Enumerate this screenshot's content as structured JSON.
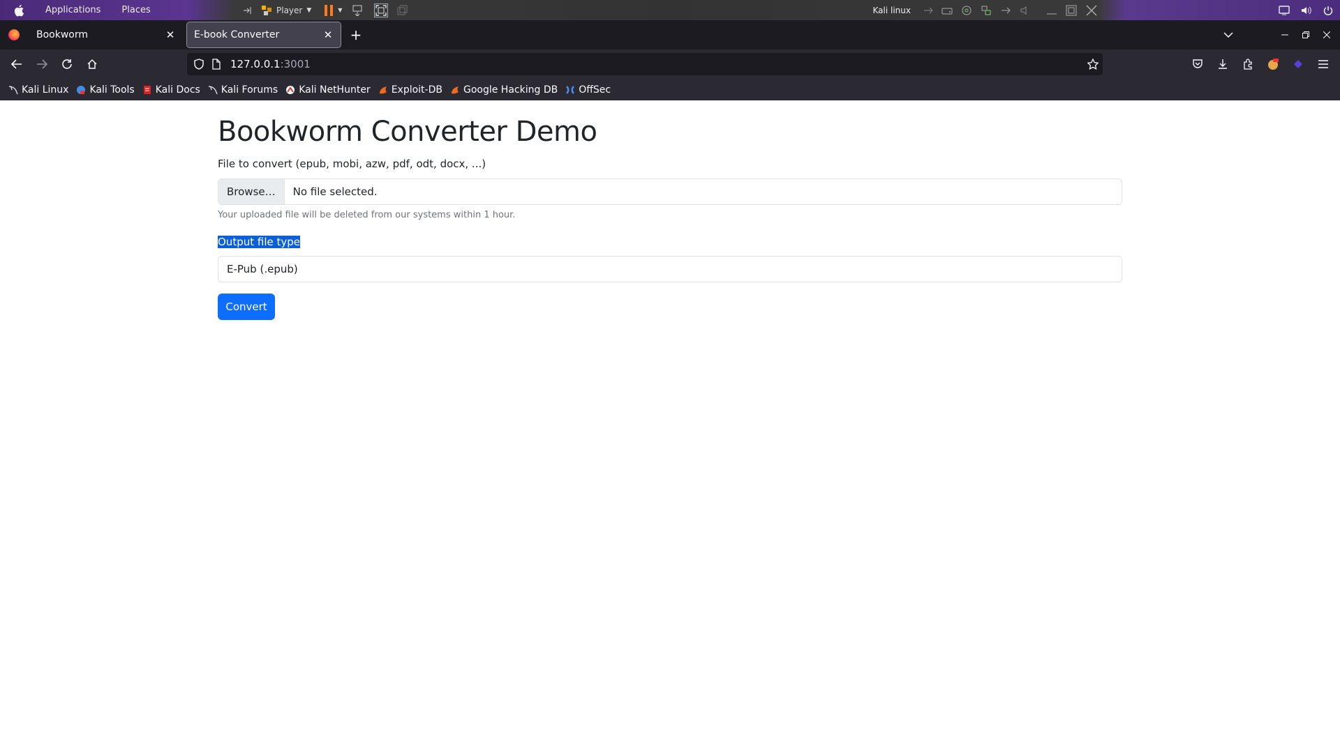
{
  "os_panel": {
    "menus": [
      "Applications",
      "Places"
    ],
    "vm_player_label": "Player",
    "vm_name": "Kali linux"
  },
  "browser": {
    "tabs": [
      {
        "label": "Bookworm",
        "active": false
      },
      {
        "label": "E-book Converter",
        "active": true
      }
    ],
    "url": {
      "host": "127.0.0.1",
      "port": ":3001"
    },
    "bookmarks": [
      {
        "label": "Kali Linux",
        "icon": "kali-dragon-icon"
      },
      {
        "label": "Kali Tools",
        "icon": "kali-tools-icon"
      },
      {
        "label": "Kali Docs",
        "icon": "kali-docs-icon"
      },
      {
        "label": "Kali Forums",
        "icon": "kali-dragon-icon"
      },
      {
        "label": "Kali NetHunter",
        "icon": "nethunter-icon"
      },
      {
        "label": "Exploit-DB",
        "icon": "exploit-db-icon"
      },
      {
        "label": "Google Hacking DB",
        "icon": "ghdb-icon"
      },
      {
        "label": "OffSec",
        "icon": "offsec-icon"
      }
    ]
  },
  "page": {
    "title": "Bookworm Converter Demo",
    "file_label": "File to convert (epub, mobi, azw, pdf, odt, docx, ...)",
    "browse_label": "Browse…",
    "file_status": "No file selected.",
    "help_text": "Your uploaded file will be deleted from our systems within 1 hour.",
    "output_label": "Output file type",
    "output_selected": "E-Pub (.epub)",
    "convert_label": "Convert"
  },
  "colors": {
    "primary": "#0d6efd",
    "selection": "#0b60d8",
    "os_panel_accent": "#5b3590"
  }
}
